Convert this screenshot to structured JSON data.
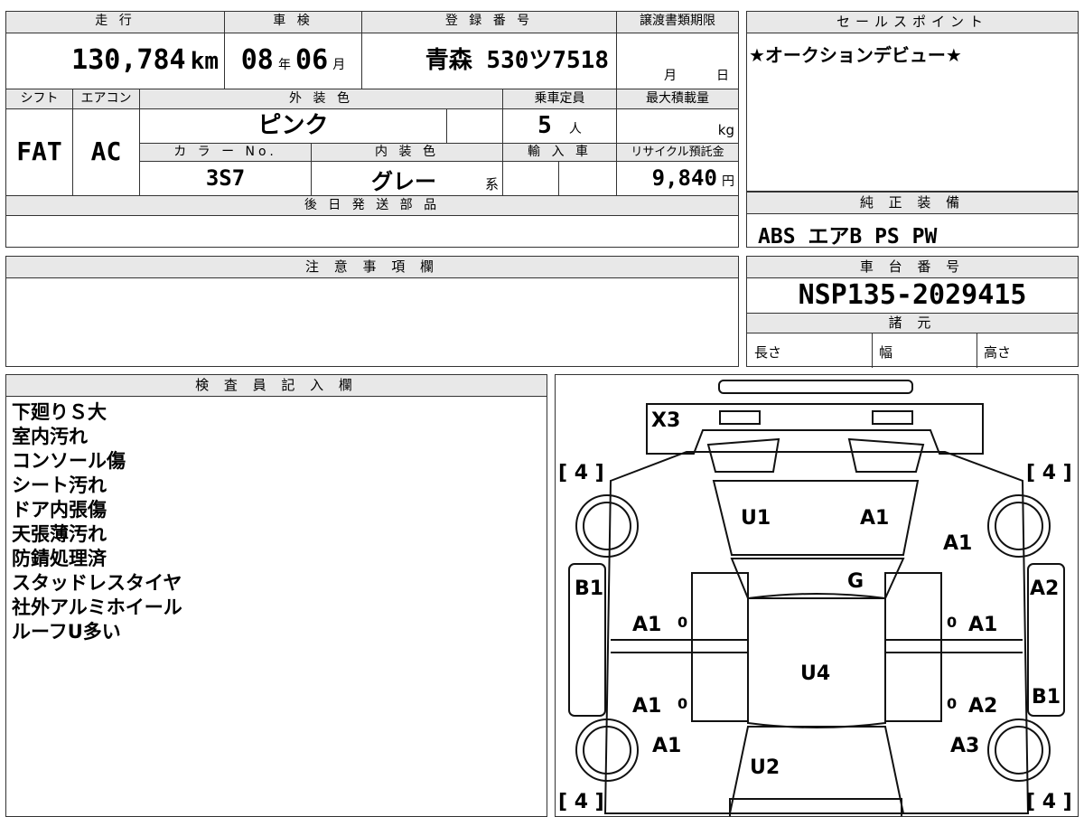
{
  "top_table": {
    "mileage_label": "走 行",
    "mileage_value": "130,784",
    "mileage_unit": "km",
    "inspection_label": "車 検",
    "inspection_year": "08",
    "inspection_year_unit": "年",
    "inspection_month": "06",
    "inspection_month_unit": "月",
    "registration_label": "登 録 番 号",
    "registration_value": "青森 530ツ7518",
    "transfer_label": "譲渡書類期限",
    "transfer_month_unit": "月",
    "transfer_day_unit": "日",
    "shift_label": "シフト",
    "shift_value": "FAT",
    "aircon_label": "エアコン",
    "aircon_value": "AC",
    "exterior_color_label": "外 装 色",
    "exterior_color_value": "ピンク",
    "capacity_label": "乗車定員",
    "capacity_value": "5",
    "capacity_unit": "人",
    "max_load_label": "最大積載量",
    "max_load_unit": "kg",
    "color_no_label": "カ ラ ー No.",
    "color_no_value": "3S7",
    "interior_color_label": "内 装 色",
    "interior_color_value": "グレー",
    "interior_color_suffix": "系",
    "import_label": "輸 入 車",
    "recycle_label": "リサイクル預託金",
    "recycle_value": "9,840",
    "recycle_unit": "円",
    "later_parts_label": "後 日 発 送 部 品"
  },
  "sales_point": {
    "label": "セールスポイント",
    "value": "★オークションデビュー★"
  },
  "standard_equipment": {
    "label": "純 正 装 備",
    "value": "ABS エアB PS PW"
  },
  "notes": {
    "label": "注 意 事 項 欄"
  },
  "chassis": {
    "label": "車 台 番 号",
    "value": "NSP135-2029415",
    "specs_label": "諸 元",
    "length_label": "長さ",
    "width_label": "幅",
    "height_label": "高さ"
  },
  "inspector": {
    "label": "検 査 員 記 入 欄",
    "lines": [
      "下廻りＳ大",
      "室内汚れ",
      "コンソール傷",
      "シート汚れ",
      "ドア内張傷",
      "天張薄汚れ",
      "防錆処理済",
      "スタッドレスタイヤ",
      "社外アルミホイール",
      "ルーフU多い"
    ]
  },
  "diagram": {
    "tire_tl": "[ 4 ]",
    "tire_tr": "[ 4 ]",
    "tire_bl": "[ 4 ]",
    "tire_br": "[ 4 ]",
    "bumper_front": "X3",
    "windshield": "U1",
    "windshield_right": "A1",
    "fender_fr": "A1",
    "hood": "G",
    "fender_l": "B1",
    "fender_r": "A2",
    "door_fl": "A1",
    "door_fr": "A1",
    "door_rl": "A1",
    "door_rr": "A2",
    "roof": "U4",
    "quarter_r": "B1",
    "rear_ql": "A1",
    "rear_qr": "A3",
    "rear_glass": "U2",
    "zero_fl": "0",
    "zero_fr": "0",
    "zero_rl": "0",
    "zero_rr": "0"
  }
}
